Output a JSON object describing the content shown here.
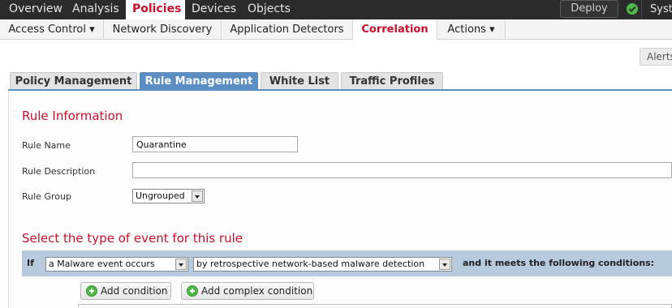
{
  "top_nav": {
    "items": [
      "Overview",
      "Analysis",
      "Policies",
      "Devices",
      "Objects"
    ],
    "active": "Policies",
    "deploy_label": "Deploy",
    "system_label": "Syst"
  },
  "sub_nav": {
    "items": [
      "Access Control ▾",
      "Network Discovery",
      "Application Detectors",
      "Correlation",
      "Actions ▾"
    ],
    "active": "Correlation"
  },
  "alerts_label": "Alerts",
  "tabs": [
    "Policy Management",
    "Rule Management",
    "White List",
    "Traffic Profiles"
  ],
  "active_tab": "Rule Management",
  "rule_info": {
    "title": "Rule Information",
    "name_label": "Rule Name",
    "name_value": "Quarantine",
    "description_label": "Rule Description",
    "description_value": "",
    "group_label": "Rule Group",
    "group_value": "Ungrouped"
  },
  "event_section": {
    "title": "Select the type of event for this rule",
    "if_label": "If",
    "event_type": "a Malware event occurs",
    "event_subtype": "by retrospective network-based malware detection",
    "conditions_text": "and it meets the following conditions:"
  },
  "buttons": {
    "add_condition": "Add condition",
    "add_complex_condition": "Add complex condition"
  },
  "colors": {
    "brand_red": "#c8102e",
    "tab_blue": "#5b8fc4",
    "condition_bar": "#b6c9dd",
    "success_green": "#4fb848"
  }
}
